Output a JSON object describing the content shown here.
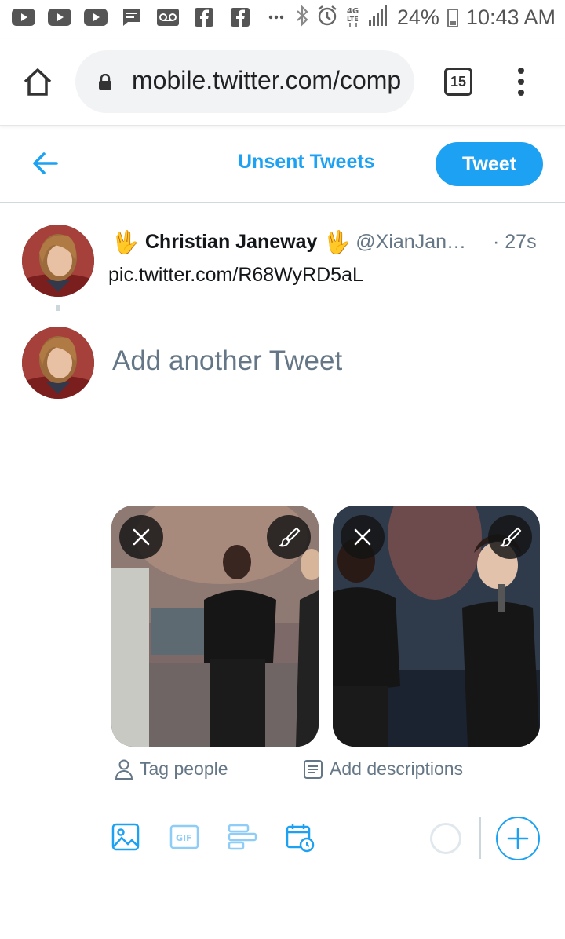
{
  "status_bar": {
    "left_icons": [
      "youtube-icon",
      "youtube-icon",
      "youtube-icon",
      "message-icon",
      "voicemail-icon",
      "facebook-icon",
      "facebook-icon",
      "more-icon"
    ],
    "network": "4G LTE",
    "battery": "24%",
    "time": "10:43 AM"
  },
  "browser": {
    "url": "mobile.twitter.com/compose/tweet",
    "tab_count": "15"
  },
  "header": {
    "title": "Unsent Tweets",
    "tweet_button": "Tweet"
  },
  "tweet": {
    "emoji_left": "🖖",
    "display_name": "Christian Janeway",
    "emoji_right": "🖖",
    "handle": "@XianJan…",
    "timestamp": "· 27s",
    "text": "pic.twitter.com/R68WyRD5aL"
  },
  "composer": {
    "placeholder": "Add another Tweet",
    "tag_people": "Tag people",
    "add_descriptions": "Add descriptions"
  },
  "colors": {
    "accent": "#1da1f2",
    "secondary_text": "#657786"
  }
}
